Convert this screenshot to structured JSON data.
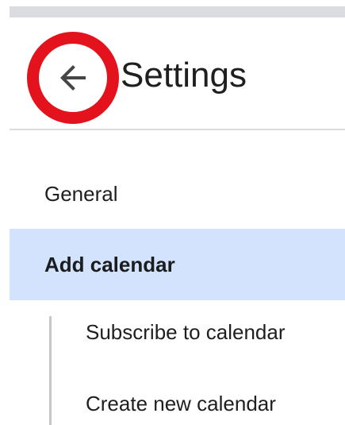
{
  "header": {
    "back_button_label": "Back",
    "title": "Settings"
  },
  "nav": {
    "items": [
      {
        "label": "General",
        "selected": false
      },
      {
        "label": "Add calendar",
        "selected": true
      },
      {
        "label": "Subscribe to calendar",
        "selected": false
      },
      {
        "label": "Create new calendar",
        "selected": false
      }
    ]
  },
  "colors": {
    "highlight_ring": "#e3121c",
    "selected_bg": "#d3e3fd",
    "divider": "#dadce0",
    "text": "#1f1f1f"
  },
  "icons": {
    "back": "arrow-left-icon"
  }
}
